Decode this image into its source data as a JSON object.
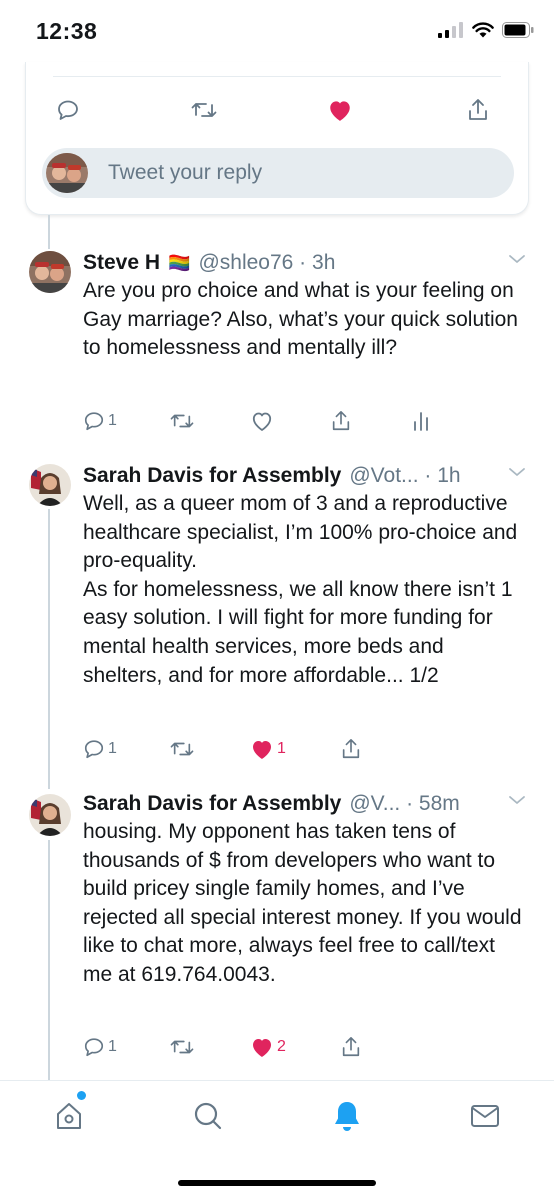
{
  "status_bar": {
    "time": "12:38"
  },
  "reply_card": {
    "reply_placeholder": "Tweet your reply",
    "liked": true
  },
  "tweets": [
    {
      "name": "Steve H",
      "name_emoji": "🏳️‍🌈",
      "handle_time": "@shleo76 · 3h",
      "text": "Are you pro choice and what is your feeling on Gay marriage?  Also, what’s your quick solution to  homelessness and mentally ill?",
      "reply_count": "1",
      "like_count": "",
      "liked": false,
      "has_analytics": true
    },
    {
      "name": "Sarah Davis for Assembly",
      "handle_time": "@Vot... · 1h",
      "text": "Well, as a queer mom of 3 and a reproductive healthcare specialist, I’m 100% pro-choice and pro-equality.\nAs for homelessness, we all know there isn’t 1 easy solution. I will fight for more funding for mental health services, more beds and shelters, and for more affordable... 1/2",
      "reply_count": "1",
      "like_count": "1",
      "liked": true
    },
    {
      "name": "Sarah Davis for Assembly",
      "handle_time": "@V... · 58m",
      "text": "housing. My opponent has taken tens of thousands of $ from developers who want to build pricey single family homes, and I’ve rejected all special interest money. If you would like to chat more, always feel free to call/text me at 619.764.0043.",
      "reply_count": "1",
      "like_count": "2",
      "liked": true
    }
  ],
  "tab_bar": {
    "active": "notifications",
    "home_has_new": true
  },
  "colors": {
    "accent": "#1da1f2",
    "like": "#e0245e",
    "secondary_text": "#657786",
    "icon_gray": "#657786",
    "divider": "#e6ecf0"
  }
}
